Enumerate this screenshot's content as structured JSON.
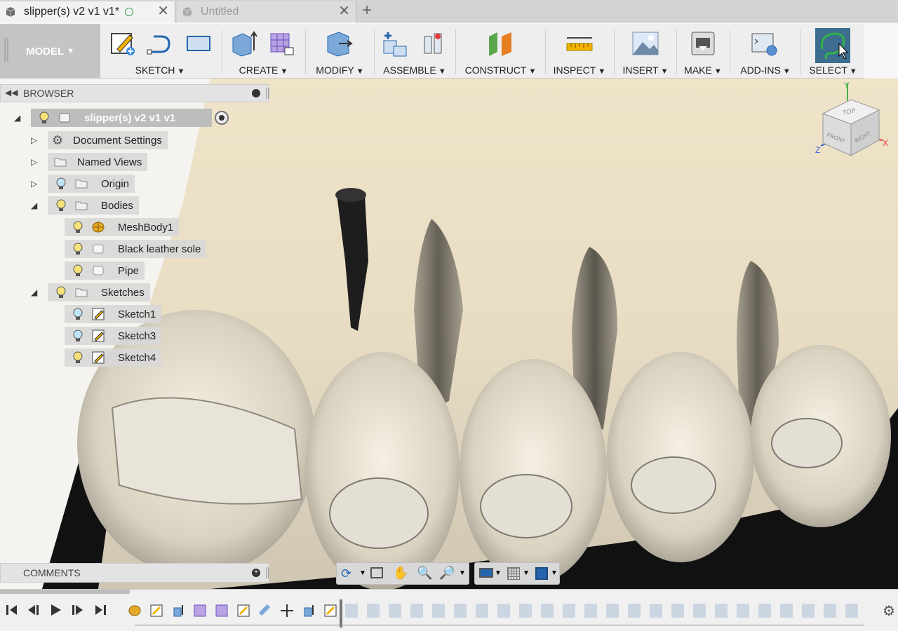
{
  "tabs": [
    {
      "title": "slipper(s) v2 v1 v1*",
      "active": true
    },
    {
      "title": "Untitled",
      "active": false
    }
  ],
  "new_tab_symbol": "+",
  "close_symbol": "✕",
  "workspace": {
    "label": "MODEL"
  },
  "toolbar": {
    "groups": [
      {
        "label": "SKETCH"
      },
      {
        "label": "CREATE"
      },
      {
        "label": "MODIFY"
      },
      {
        "label": "ASSEMBLE"
      },
      {
        "label": "CONSTRUCT"
      },
      {
        "label": "INSPECT"
      },
      {
        "label": "INSERT"
      },
      {
        "label": "MAKE"
      },
      {
        "label": "ADD-INS"
      },
      {
        "label": "SELECT"
      }
    ]
  },
  "browser": {
    "title": "BROWSER",
    "root": "slipper(s) v2 v1 v1",
    "items": [
      {
        "label": "Document Settings"
      },
      {
        "label": "Named Views"
      },
      {
        "label": "Origin"
      },
      {
        "label": "Bodies"
      },
      {
        "label": "MeshBody1"
      },
      {
        "label": "Black leather sole"
      },
      {
        "label": "Pipe"
      },
      {
        "label": "Sketches"
      },
      {
        "label": "Sketch1"
      },
      {
        "label": "Sketch3"
      },
      {
        "label": "Sketch4"
      }
    ]
  },
  "comments": {
    "title": "COMMENTS"
  },
  "viewcube": {
    "top": "TOP",
    "front": "FRONT",
    "right": "RIGHT",
    "axis_x": "X",
    "axis_y": "Y",
    "axis_z": "Z"
  },
  "colors": {
    "accent": "#2f6fb5",
    "toolbar_bg": "#eeeeee",
    "model_bg": "#c4c4c4",
    "select_active": "#3d6d8f"
  }
}
